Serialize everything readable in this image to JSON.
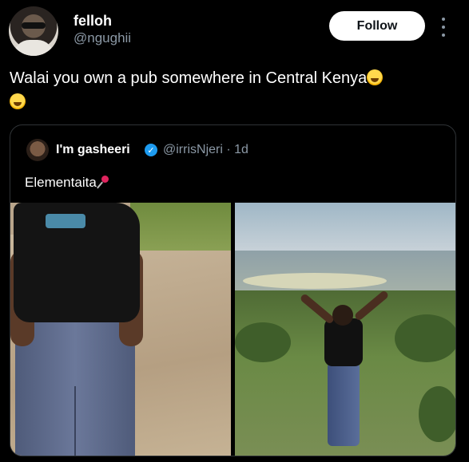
{
  "tweet": {
    "display_name": "felloh",
    "handle": "@ngughii",
    "follow_label": "Follow",
    "text": "Walai you own a pub somewhere in Central Kenya"
  },
  "quote": {
    "display_name": "I'm gasheeri",
    "handle_time": "@irrisNjeri · 1d",
    "text": "Elementaita"
  },
  "colors": {
    "background": "#000000",
    "verified": "#1d9bf0",
    "muted": "#8b98a5"
  },
  "icons": [
    "verified-badge-icon",
    "more-options-icon",
    "pin-icon",
    "laughing-emoji-icon",
    "rolling-laughing-emoji-icon"
  ]
}
